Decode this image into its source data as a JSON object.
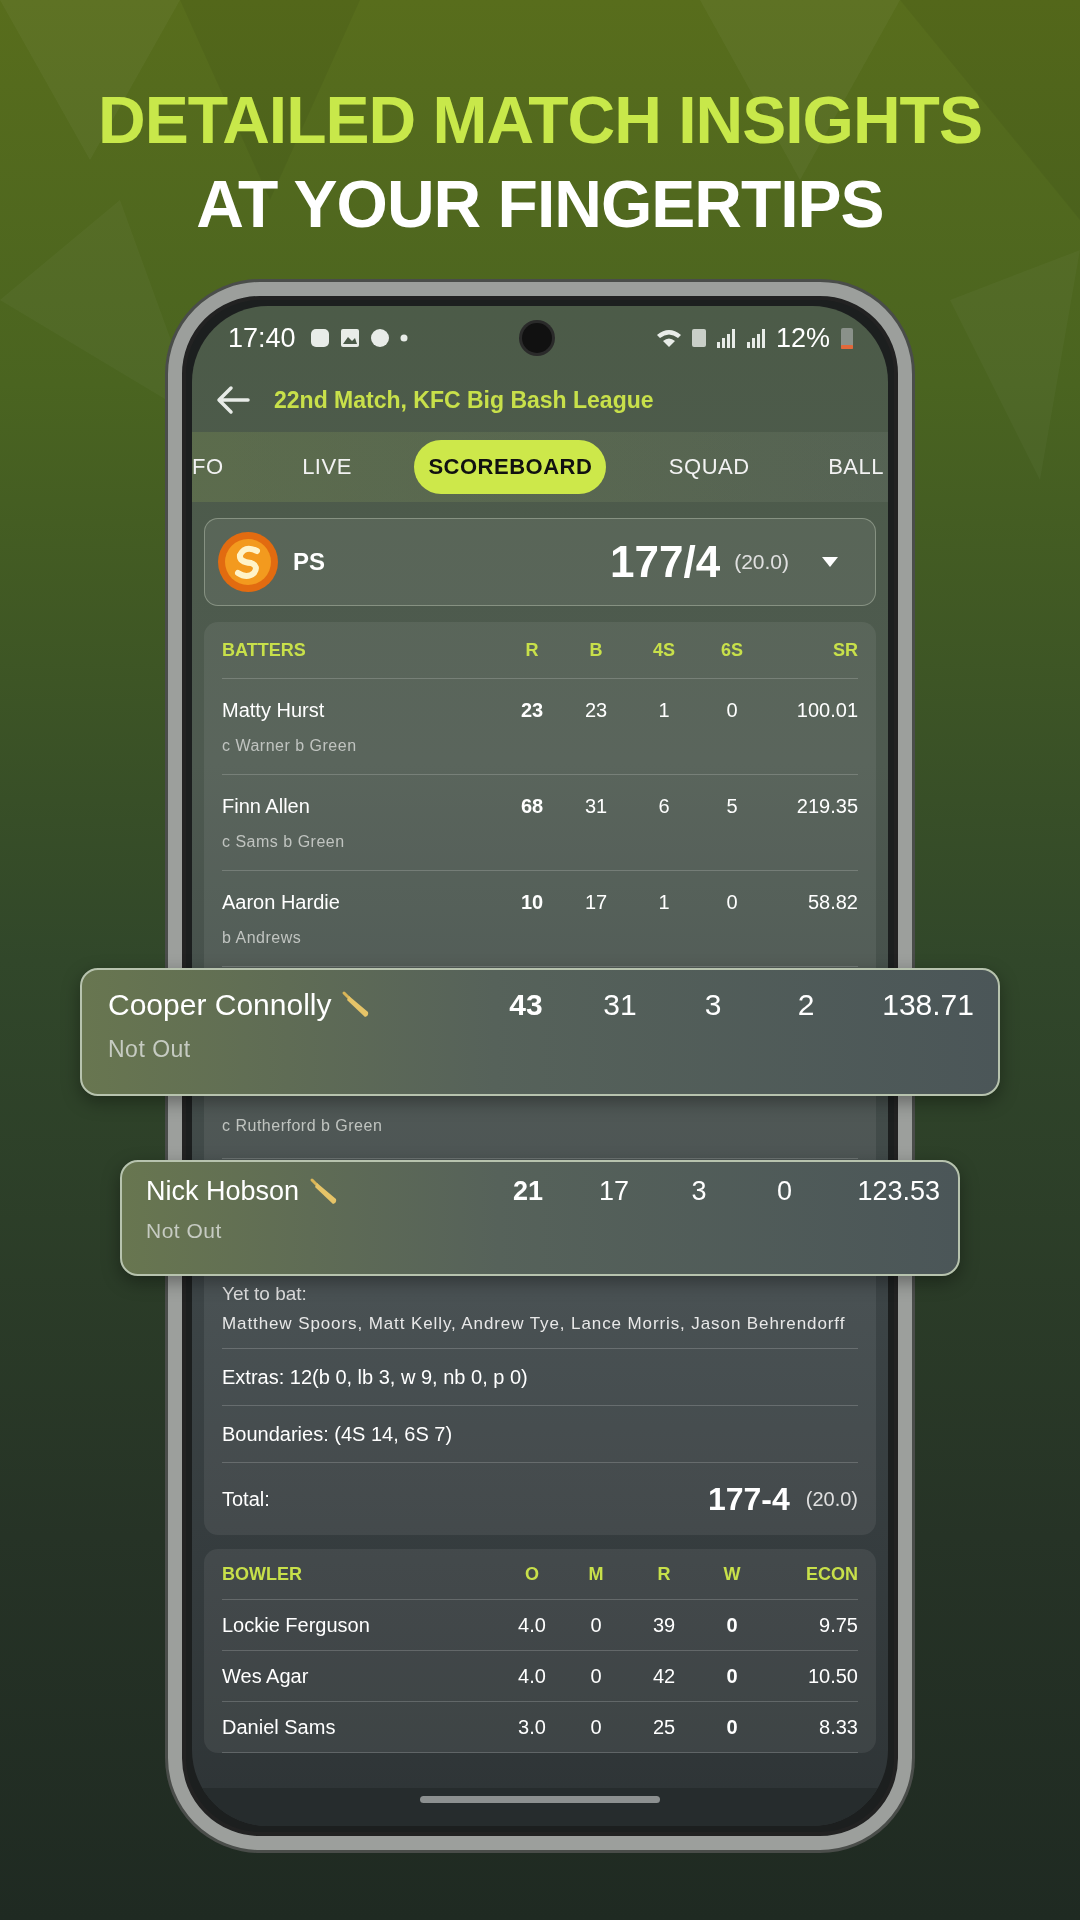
{
  "headline": {
    "line_1": "DETAILED MATCH INSIGHTS",
    "line_2": "AT YOUR FINGERTIPS"
  },
  "status_bar": {
    "time": "17:40",
    "battery": "12%"
  },
  "header": {
    "title": "22nd Match, KFC Big Bash League"
  },
  "tabs": [
    {
      "label": "FO",
      "selected": false
    },
    {
      "label": "LIVE",
      "selected": false
    },
    {
      "label": "SCOREBOARD",
      "selected": true
    },
    {
      "label": "SQUAD",
      "selected": false
    },
    {
      "label": "BALL",
      "selected": false
    }
  ],
  "team": {
    "name": "PS",
    "score": "177/4",
    "overs": "(20.0)"
  },
  "batting": {
    "columns": [
      "BATTERS",
      "R",
      "B",
      "4S",
      "6S",
      "SR"
    ],
    "rows": [
      {
        "name": "Matty Hurst",
        "r": "23",
        "b": "23",
        "fours": "1",
        "sixes": "0",
        "sr": "100.01",
        "dismissal": "c Warner b Green"
      },
      {
        "name": "Finn Allen",
        "r": "68",
        "b": "31",
        "fours": "6",
        "sixes": "5",
        "sr": "219.35",
        "dismissal": "c Sams b Green"
      },
      {
        "name": "Aaron Hardie",
        "r": "10",
        "b": "17",
        "fours": "1",
        "sixes": "0",
        "sr": "58.82",
        "dismissal": "b Andrews"
      }
    ],
    "partial_row": {
      "dismissal": "c Rutherford b Green"
    },
    "yet_to_bat": {
      "label": "Yet to bat:",
      "names": "Matthew Spoors, Matt Kelly, Andrew Tye, Lance Morris, Jason Behrendorff"
    },
    "extras": {
      "label": "Extras:",
      "value": "12(b 0, lb 3, w 9, nb 0, p 0)"
    },
    "boundaries": {
      "label": "Boundaries:",
      "value": "(4S 14, 6S 7)"
    },
    "total": {
      "label": "Total:",
      "score": "177-4",
      "overs": "(20.0)"
    }
  },
  "highlighted_batters": [
    {
      "name": "Cooper Connolly",
      "r": "43",
      "b": "31",
      "fours": "3",
      "sixes": "2",
      "sr": "138.71",
      "status": "Not Out"
    },
    {
      "name": "Nick Hobson",
      "r": "21",
      "b": "17",
      "fours": "3",
      "sixes": "0",
      "sr": "123.53",
      "status": "Not Out"
    }
  ],
  "bowling": {
    "columns": [
      "BOWLER",
      "O",
      "M",
      "R",
      "W",
      "ECON"
    ],
    "rows": [
      {
        "name": "Lockie Ferguson",
        "o": "4.0",
        "m": "0",
        "r": "39",
        "w": "0",
        "econ": "9.75"
      },
      {
        "name": "Wes Agar",
        "o": "4.0",
        "m": "0",
        "r": "42",
        "w": "0",
        "econ": "10.50"
      },
      {
        "name": "Daniel Sams",
        "o": "3.0",
        "m": "0",
        "r": "25",
        "w": "0",
        "econ": "8.33"
      }
    ]
  }
}
